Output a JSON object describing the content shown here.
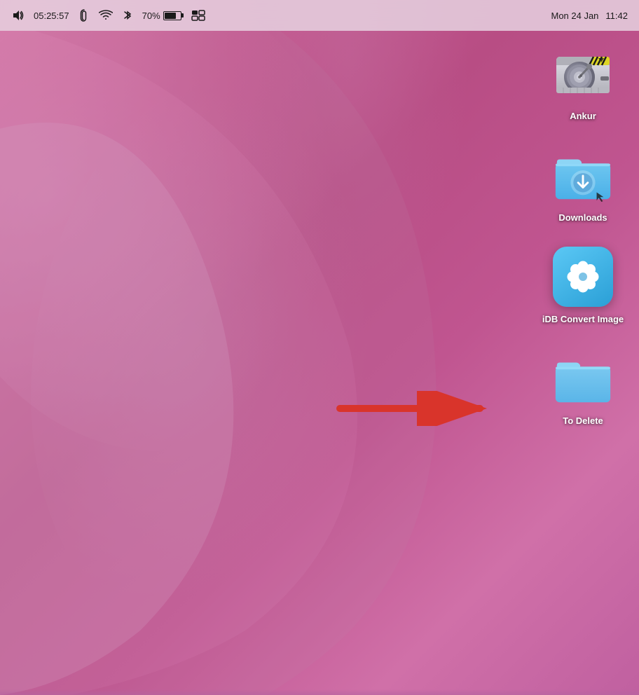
{
  "menubar": {
    "volume_label": "🔊",
    "time": "05:25:57",
    "date": "Mon 24 Jan",
    "clock_time": "11:42",
    "battery_percent": "70%",
    "wifi_label": "WiFi",
    "bluetooth_label": "BT"
  },
  "desktop": {
    "icons": [
      {
        "id": "ankur",
        "label": "Ankur",
        "type": "harddrive"
      },
      {
        "id": "downloads",
        "label": "Downloads",
        "type": "folder-download"
      },
      {
        "id": "idb-convert",
        "label": "iDB Convert Image",
        "type": "app"
      },
      {
        "id": "to-delete",
        "label": "To Delete",
        "type": "folder-plain"
      }
    ]
  },
  "arrow": {
    "color": "#d9342b"
  }
}
